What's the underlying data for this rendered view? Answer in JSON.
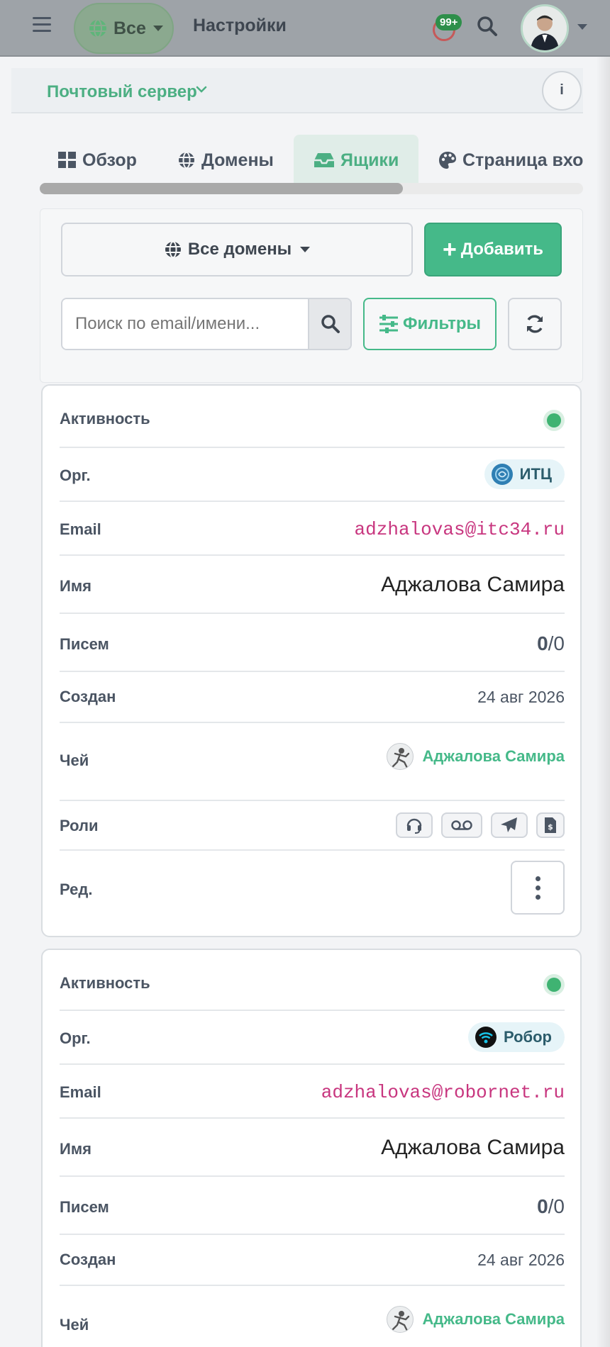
{
  "topbar": {
    "scope_label": "Все",
    "title": "Настройки",
    "notifications_badge": "99+",
    "icons": [
      "hamburger-icon",
      "globe-icon",
      "bell-icon",
      "search-icon",
      "avatar"
    ]
  },
  "section": {
    "title": "Почтовый сервер",
    "info_label": "i"
  },
  "tabs": [
    {
      "label": "Обзор",
      "icon": "grid-icon",
      "active": false
    },
    {
      "label": "Домены",
      "icon": "globe-icon",
      "active": false
    },
    {
      "label": "Ящики",
      "icon": "inbox-icon",
      "active": true
    },
    {
      "label": "Страница входа",
      "icon": "palette-icon",
      "active": false
    }
  ],
  "toolbar": {
    "domains_label": "Все домены",
    "add_label": "Добавить",
    "search_placeholder": "Поиск по email/имени...",
    "filters_label": "Фильтры"
  },
  "labels": {
    "active": "Активность",
    "org": "Орг.",
    "email": "Email",
    "name": "Имя",
    "letters": "Писем",
    "created": "Создан",
    "owner": "Чей",
    "roles": "Роли",
    "edit": "Ред."
  },
  "mailboxes": [
    {
      "active": true,
      "org": "ИТЦ",
      "email": "adzhalovas@itc34.ru",
      "name": "Аджалова Самира",
      "letters_used": "0",
      "letters_total": "/0",
      "created": "24 авг 2026",
      "owner": "Аджалова Самира",
      "roles": [
        "headset-icon",
        "voicemail-icon",
        "paper-plane-icon",
        "invoice-icon"
      ]
    },
    {
      "active": true,
      "org": "Робор",
      "email": "adzhalovas@robornet.ru",
      "name": "Аджалова Самира",
      "letters_used": "0",
      "letters_total": "/0",
      "created": "24 авг 2026",
      "owner": "Аджалова Самира"
    }
  ],
  "colors": {
    "accent": "#45b989",
    "email": "#c8367f",
    "active_dot": "#3fb372",
    "topbar": "#9ea3a8"
  }
}
